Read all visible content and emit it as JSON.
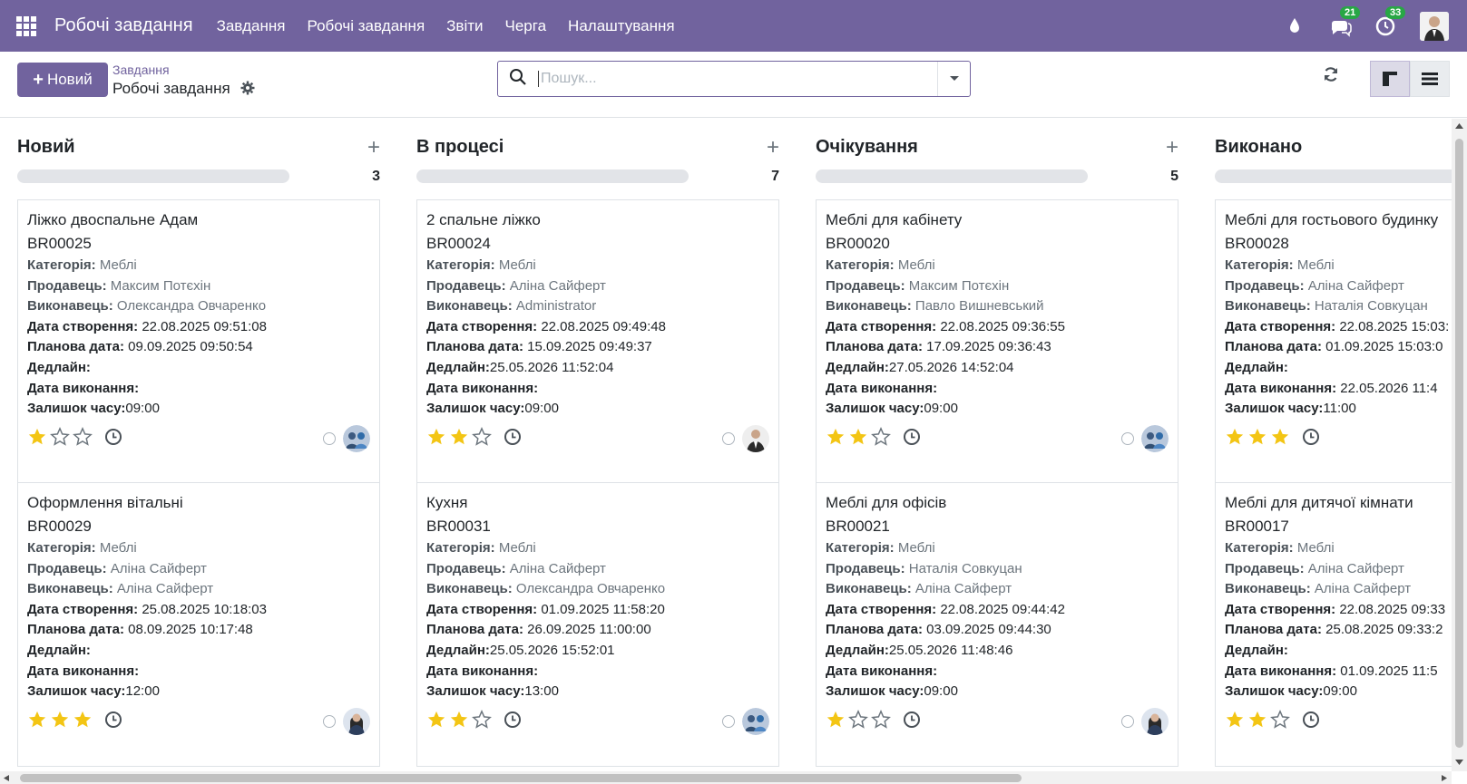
{
  "navbar": {
    "app_title": "Робочі завдання",
    "menu": [
      "Завдання",
      "Робочі завдання",
      "Звіти",
      "Черга",
      "Налаштування"
    ],
    "messages_badge": "21",
    "activities_badge": "33",
    "bg_color": "#71639e"
  },
  "control": {
    "new_button": "Новий",
    "breadcrumb_parent": "Завдання",
    "breadcrumb_current": "Робочі завдання",
    "search_placeholder": "Пошук..."
  },
  "labels": {
    "category": "Категорія:",
    "seller": "Продавець:",
    "executor": "Виконавець:",
    "created": "Дата створення:",
    "planned": "Планова дата:",
    "deadline": "Дедлайн:",
    "done": "Дата виконання:",
    "remaining": "Залишок часу:"
  },
  "columns": [
    {
      "title": "Новий",
      "count": "3",
      "cards": [
        {
          "title": "Ліжко двоспальне Адам",
          "ref": "BR00025",
          "category": "Меблі",
          "seller": "Максим Потєхін",
          "executor": "Олександра Овчаренко",
          "created": "22.08.2025 09:51:08",
          "planned": "09.09.2025 09:50:54",
          "deadline": "",
          "done": "",
          "remaining": "09:00",
          "stars": 1,
          "avatar": "team"
        },
        {
          "title": "Оформлення вітальні",
          "ref": "BR00029",
          "category": "Меблі",
          "seller": "Аліна Сайферт",
          "executor": "Аліна Сайферт",
          "created": "25.08.2025 10:18:03",
          "planned": "08.09.2025 10:17:48",
          "deadline": "",
          "done": "",
          "remaining": "12:00",
          "stars": 3,
          "avatar": "woman"
        }
      ]
    },
    {
      "title": "В процесі",
      "count": "7",
      "cards": [
        {
          "title": "2 спальне ліжко",
          "ref": "BR00024",
          "category": "Меблі",
          "seller": "Аліна Сайферт",
          "executor": "Administrator",
          "created": "22.08.2025 09:49:48",
          "planned": "15.09.2025 09:49:37",
          "deadline": "25.05.2026 11:52:04",
          "done": "",
          "remaining": "09:00",
          "stars": 2,
          "avatar": "man"
        },
        {
          "title": "Кухня",
          "ref": "BR00031",
          "category": "Меблі",
          "seller": "Аліна Сайферт",
          "executor": "Олександра Овчаренко",
          "created": "01.09.2025 11:58:20",
          "planned": "26.09.2025 11:00:00",
          "deadline": "25.05.2026 15:52:01",
          "done": "",
          "remaining": "13:00",
          "stars": 2,
          "avatar": "team"
        }
      ]
    },
    {
      "title": "Очікування",
      "count": "5",
      "cards": [
        {
          "title": "Меблі для кабінету",
          "ref": "BR00020",
          "category": "Меблі",
          "seller": "Максим Потєхін",
          "executor": "Павло Вишневський",
          "created": "22.08.2025 09:36:55",
          "planned": "17.09.2025 09:36:43",
          "deadline": "27.05.2026 14:52:04",
          "done": "",
          "remaining": "09:00",
          "stars": 2,
          "avatar": "team"
        },
        {
          "title": "Меблі для офісів",
          "ref": "BR00021",
          "category": "Меблі",
          "seller": "Наталія Совкуцан",
          "executor": "Аліна Сайферт",
          "created": "22.08.2025 09:44:42",
          "planned": "03.09.2025 09:44:30",
          "deadline": "25.05.2026 11:48:46",
          "done": "",
          "remaining": "09:00",
          "stars": 1,
          "avatar": "woman"
        }
      ]
    },
    {
      "title": "Виконано",
      "count": "",
      "cards": [
        {
          "title": "Меблі для гостьового будинку",
          "ref": "BR00028",
          "category": "Меблі",
          "seller": "Аліна Сайферт",
          "executor": "Наталія Совкуцан",
          "created": "22.08.2025 15:03:",
          "planned": "01.09.2025 15:03:0",
          "deadline": "",
          "done": "22.05.2026 11:4",
          "remaining": "11:00",
          "stars": 3,
          "avatar": ""
        },
        {
          "title": "Меблі для дитячої кімнати",
          "ref": "BR00017",
          "category": "Меблі",
          "seller": "Аліна Сайферт",
          "executor": "Аліна Сайферт",
          "created": "22.08.2025 09:33",
          "planned": "25.08.2025 09:33:2",
          "deadline": "",
          "done": "01.09.2025 11:5",
          "remaining": "09:00",
          "stars": 2,
          "avatar": ""
        }
      ]
    }
  ]
}
